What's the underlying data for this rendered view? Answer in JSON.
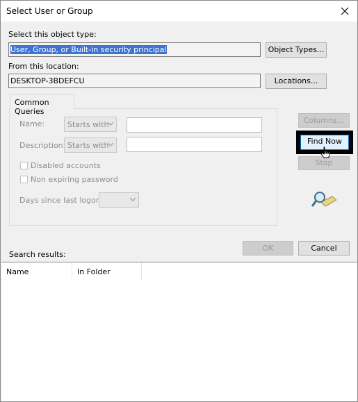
{
  "window": {
    "title": "Select User or Group"
  },
  "object_type": {
    "label": "Select this object type:",
    "value": "User, Group, or Built-in security principal",
    "button": "Object Types..."
  },
  "location": {
    "label": "From this location:",
    "value": "DESKTOP-3BDEFCU",
    "button": "Locations..."
  },
  "tabs": {
    "common_queries": "Common Queries"
  },
  "query": {
    "name_label": "Name:",
    "name_mode": "Starts with",
    "description_label": "Description:",
    "description_mode": "Starts with",
    "disabled_accounts": "Disabled accounts",
    "non_expiring_password": "Non expiring password",
    "days_since_logon_label": "Days since last logon:"
  },
  "side_buttons": {
    "columns": "Columns...",
    "find_now": "Find Now",
    "stop": "Stop"
  },
  "dialog_buttons": {
    "ok": "OK",
    "cancel": "Cancel"
  },
  "results": {
    "label": "Search results:",
    "columns": [
      "Name",
      "In Folder"
    ]
  }
}
